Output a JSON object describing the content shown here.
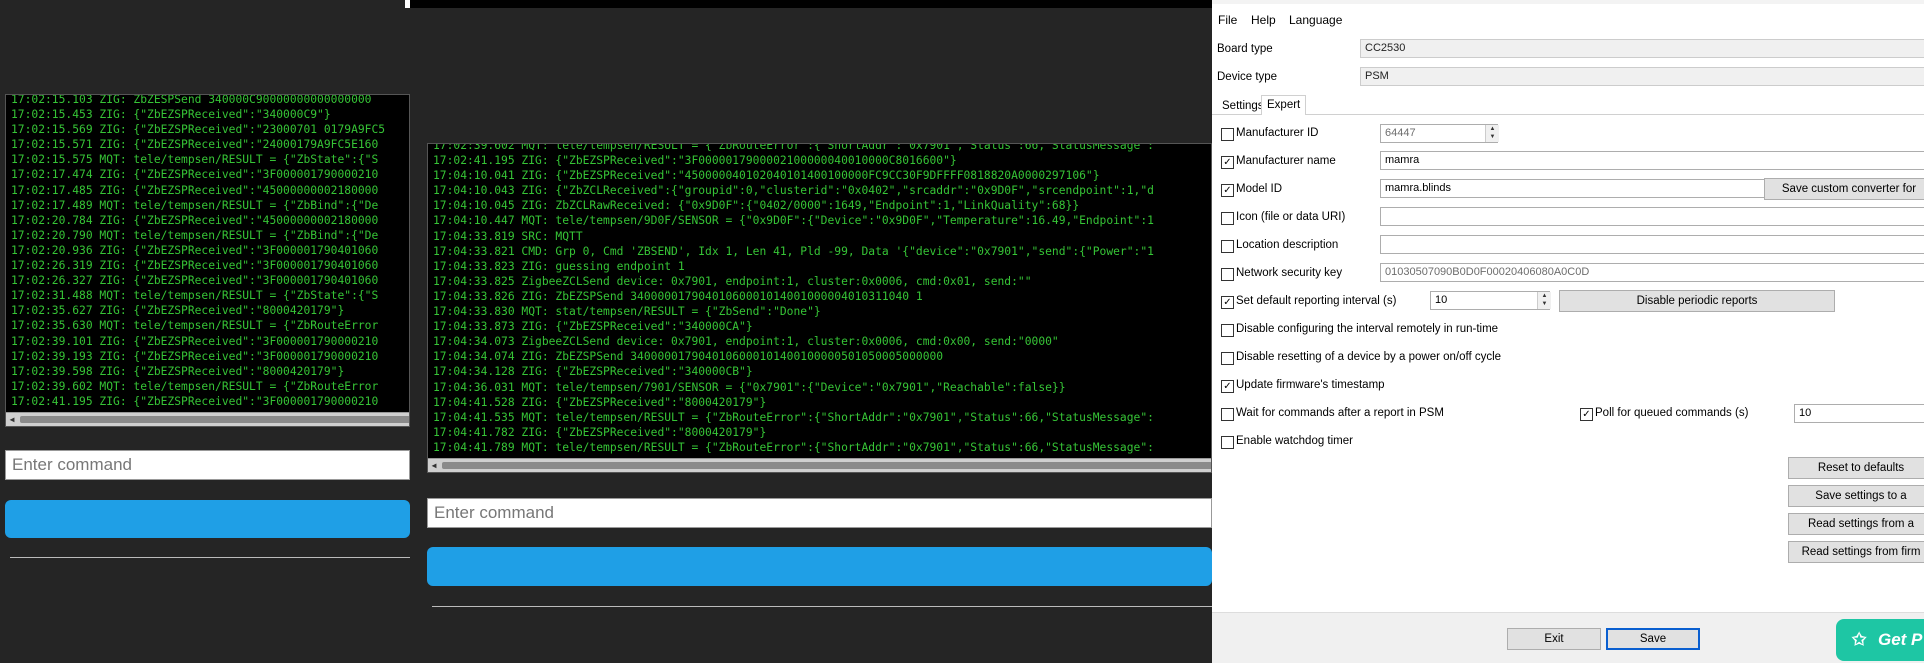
{
  "console_left": {
    "lines": [
      "17:02:15.103 ZIG: ZbZESPSend 340000C90000000000000000",
      "17:02:15.453 ZIG: {\"ZbEZSPReceived\":\"340000C9\"}",
      "17:02:15.569 ZIG: {\"ZbEZSPReceived\":\"23000701 0179A9FC5",
      "17:02:15.571 ZIG: {\"ZbEZSPReceived\":\"24000179A9FC5E160",
      "17:02:15.575 MQT: tele/tempsen/RESULT = {\"ZbState\":{\"S",
      "17:02:17.474 ZIG: {\"ZbEZSPReceived\":\"3F000001790000210",
      "17:02:17.485 ZIG: {\"ZbEZSPReceived\":\"45000000002180000",
      "17:02:17.489 MQT: tele/tempsen/RESULT = {\"ZbBind\":{\"De",
      "17:02:20.784 ZIG: {\"ZbEZSPReceived\":\"45000000002180000",
      "17:02:20.790 MQT: tele/tempsen/RESULT = {\"ZbBind\":{\"De",
      "17:02:20.936 ZIG: {\"ZbEZSPReceived\":\"3F000001790401060",
      "17:02:26.319 ZIG: {\"ZbEZSPReceived\":\"3F000001790401060",
      "17:02:26.327 ZIG: {\"ZbEZSPReceived\":\"3F000001790401060",
      "17:02:31.488 MQT: tele/tempsen/RESULT = {\"ZbState\":{\"S",
      "17:02:35.627 ZIG: {\"ZbEZSPReceived\":\"8000420179\"}",
      "17:02:35.630 MQT: tele/tempsen/RESULT = {\"ZbRouteError",
      "17:02:39.101 ZIG: {\"ZbEZSPReceived\":\"3F000001790000210",
      "17:02:39.193 ZIG: {\"ZbEZSPReceived\":\"3F000001790000210",
      "17:02:39.598 ZIG: {\"ZbEZSPReceived\":\"8000420179\"}",
      "17:02:39.602 MQT: tele/tempsen/RESULT = {\"ZbRouteError",
      "17:02:41.195 ZIG: {\"ZbEZSPReceived\":\"3F000001790000210"
    ],
    "placeholder": "Enter command"
  },
  "console_middle": {
    "lines": [
      "17:02:39.602 MQT: tele/tempsen/RESULT = {\"ZbRouteError\":{\"ShortAddr\":\"0x7901\",\"Status\":66,\"StatusMessage\":",
      "17:02:41.195 ZIG: {\"ZbEZSPReceived\":\"3F0000017900002100000040010000C8016600\"}",
      "17:04:10.041 ZIG: {\"ZbEZSPReceived\":\"450000040102040101400100000FC9CC30F9DFFFF0818820A0000297106\"}",
      "17:04:10.043 ZIG: {\"ZbZCLReceived\":{\"groupid\":0,\"clusterid\":\"0x0402\",\"srcaddr\":\"0x9D0F\",\"srcendpoint\":1,\"d",
      "17:04:10.045 ZIG: ZbZCLRawReceived: {\"0x9D0F\":{\"0402/0000\":1649,\"Endpoint\":1,\"LinkQuality\":68}}",
      "17:04:10.447 MQT: tele/tempsen/9D0F/SENSOR = {\"0x9D0F\":{\"Device\":\"0x9D0F\",\"Temperature\":16.49,\"Endpoint\":1",
      "17:04:33.819 SRC: MQTT",
      "17:04:33.821 CMD: Grp 0, Cmd 'ZBSEND', Idx 1, Len 41, Pld -99, Data '{\"device\":\"0x7901\",\"send\":{\"Power\":\"1",
      "17:04:33.823 ZIG: guessing endpoint 1",
      "17:04:33.825 ZigbeeZCLSend device: 0x7901, endpoint:1, cluster:0x0006, cmd:0x01, send:\"\"",
      "17:04:33.826 ZIG: ZbEZSPSend 34000001790401060001014001000004010311040 1",
      "17:04:33.830 MQT: stat/tempsen/RESULT = {\"ZbSend\":\"Done\"}",
      "17:04:33.873 ZIG: {\"ZbEZSPReceived\":\"340000CA\"}",
      "17:04:34.073 ZigbeeZCLSend device: 0x7901, endpoint:1, cluster:0x0006, cmd:0x00, send:\"0000\"",
      "17:04:34.074 ZIG: ZbEZSPSend 3400000179040106000101400100000501050005000000",
      "17:04:34.128 ZIG: {\"ZbEZSPReceived\":\"340000CB\"}",
      "17:04:36.031 MQT: tele/tempsen/7901/SENSOR = {\"0x7901\":{\"Device\":\"0x7901\",\"Reachable\":false}}",
      "17:04:41.528 ZIG: {\"ZbEZSPReceived\":\"8000420179\"}",
      "17:04:41.535 MQT: tele/tempsen/RESULT = {\"ZbRouteError\":{\"ShortAddr\":\"0x7901\",\"Status\":66,\"StatusMessage\":",
      "17:04:41.782 ZIG: {\"ZbEZSPReceived\":\"8000420179\"}",
      "17:04:41.789 MQT: tele/tempsen/RESULT = {\"ZbRouteError\":{\"ShortAddr\":\"0x7901\",\"Status\":66,\"StatusMessage\":"
    ],
    "placeholder": "Enter command"
  },
  "window": {
    "menu": {
      "file": "File",
      "help": "Help",
      "language": "Language"
    },
    "board_type_label": "Board type",
    "board_type_value": "CC2530",
    "device_type_label": "Device type",
    "device_type_value": "PSM",
    "tabs": {
      "settings": "Settings",
      "expert": "Expert"
    },
    "manufacturer_id": {
      "label": "Manufacturer ID",
      "value": "64447",
      "checked": false
    },
    "manufacturer_name": {
      "label": "Manufacturer name",
      "value": "mamra",
      "checked": true
    },
    "model_id": {
      "label": "Model ID",
      "value": "mamra.blinds",
      "checked": true,
      "button": "Save custom converter for"
    },
    "icon": {
      "label": "Icon (file or data URI)",
      "value": "",
      "checked": false
    },
    "location": {
      "label": "Location description",
      "value": "",
      "checked": false
    },
    "network_key": {
      "label": "Network security key",
      "value": "01030507090B0D0F00020406080A0C0D",
      "checked": false
    },
    "reporting": {
      "label": "Set default reporting interval (s)",
      "value": "10",
      "checked": true,
      "button": "Disable periodic reports"
    },
    "disable_interval": {
      "label": "Disable configuring the interval remotely in run-time",
      "checked": false
    },
    "disable_reset": {
      "label": "Disable resetting of a device by a power on/off cycle",
      "checked": false
    },
    "update_timestamp": {
      "label": "Update firmware's timestamp",
      "checked": true
    },
    "wait_commands": {
      "label": "Wait for commands after a report in PSM",
      "checked": false
    },
    "poll_commands": {
      "label": "Poll for queued commands (s)",
      "value": "10",
      "checked": true
    },
    "watchdog": {
      "label": "Enable watchdog timer",
      "checked": false
    },
    "side_buttons": {
      "reset": "Reset to defaults",
      "save_to": "Save settings to a",
      "read_from": "Read settings from a",
      "read_firmware": "Read settings from firm"
    },
    "exit_button": "Exit",
    "save_button": "Save",
    "get_button": "Get P"
  },
  "colors": {
    "console_text": "#36c436",
    "send_button": "#1f9fe6",
    "get_button": "#1ec6a4"
  }
}
